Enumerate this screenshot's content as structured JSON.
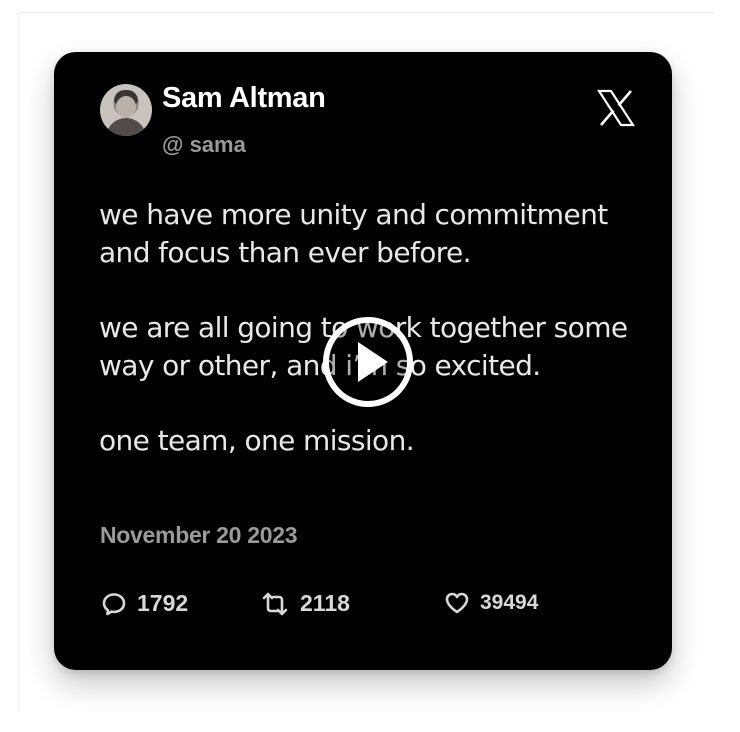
{
  "tweet": {
    "author_name": "Sam Altman",
    "handle": "@ sama",
    "paragraphs": [
      "we have more unity and commitment and focus than ever before.",
      "we are all going to work together some way or other, and i’m so excited.",
      "one team, one mission."
    ],
    "date": "November 20 2023",
    "stats": {
      "replies": "1792",
      "retweets": "2118",
      "likes": "39494"
    }
  },
  "icons": {
    "brand": "x-logo-icon",
    "reply": "comment-bubble-icon",
    "retweet": "retweet-icon",
    "like": "heart-icon",
    "play": "play-icon"
  },
  "colors": {
    "card_background": "#000000",
    "primary_text": "#ffffff",
    "secondary_text": "#9a9a9a"
  }
}
